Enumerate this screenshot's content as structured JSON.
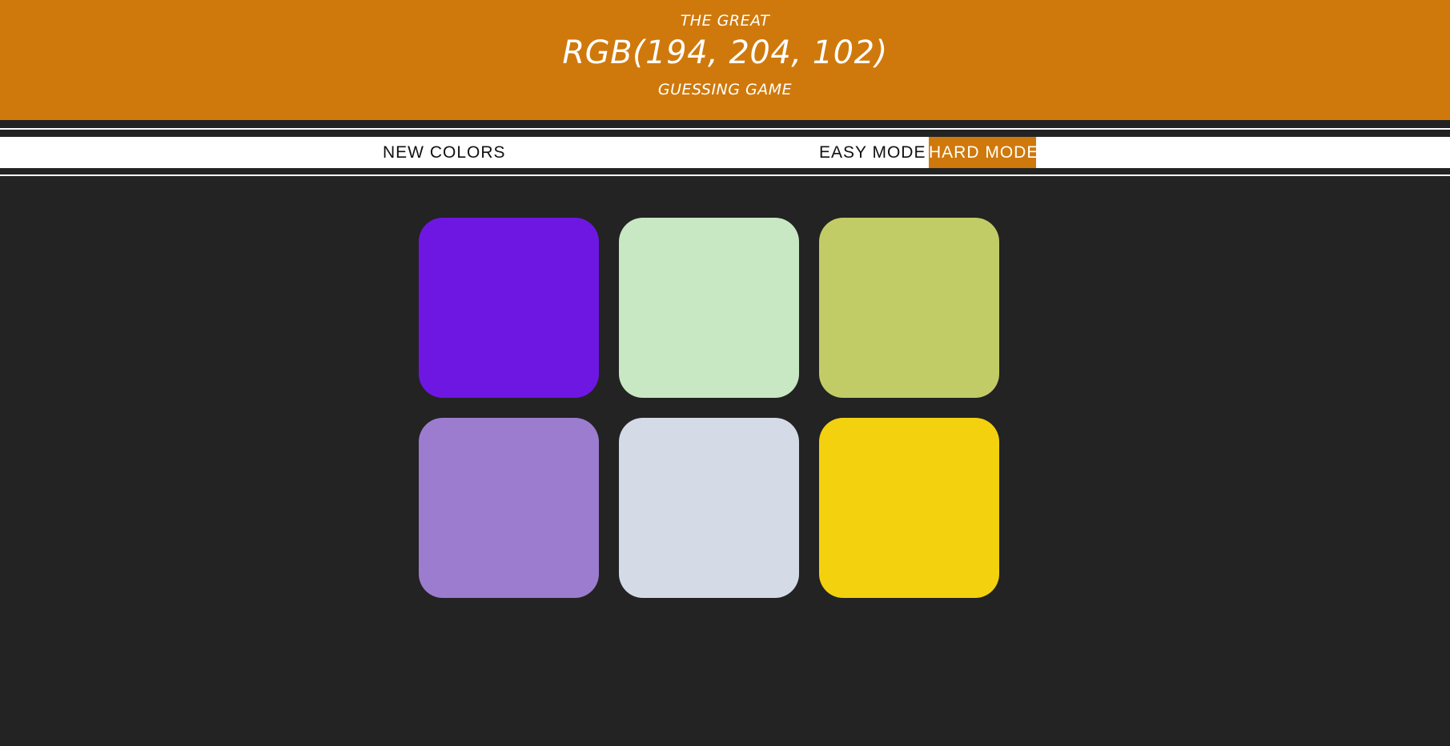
{
  "header": {
    "pre_title": "THE GREAT",
    "target_color": "RGB(194, 204, 102)",
    "post_title": "GUESSING GAME",
    "background": "#cf790c"
  },
  "controls": {
    "new_colors_label": "NEW COLORS",
    "easy_mode_label": "EASY MODE",
    "hard_mode_label": "HARD MODE",
    "selected_mode": "HARD MODE"
  },
  "squares": [
    {
      "color": "#6e17e3"
    },
    {
      "color": "#c8e8c3"
    },
    {
      "color": "#c2cc66"
    },
    {
      "color": "#9c7ccf"
    },
    {
      "color": "#d4dae6"
    },
    {
      "color": "#f3d10f"
    }
  ],
  "colors": {
    "page_background": "#232323",
    "accent": "#cf790c"
  }
}
